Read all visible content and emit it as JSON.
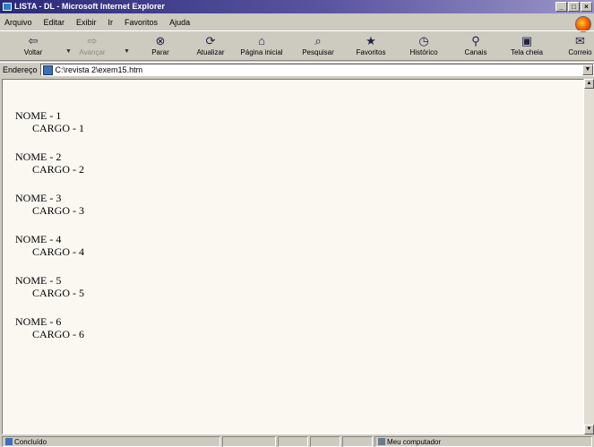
{
  "window": {
    "title": "LISTA - DL - Microsoft Internet Explorer",
    "controls": [
      "_",
      "□",
      "×"
    ]
  },
  "menu": [
    "Arquivo",
    "Editar",
    "Exibir",
    "Ir",
    "Favoritos",
    "Ajuda"
  ],
  "toolbar": [
    {
      "label": "Voltar",
      "icon": "back-arrow-icon",
      "glyph": "⇦",
      "enabled": true
    },
    {
      "label": "Avançar",
      "icon": "forward-arrow-icon",
      "glyph": "⇨",
      "enabled": false
    },
    {
      "label": "Parar",
      "icon": "stop-icon",
      "glyph": "⊗",
      "enabled": true
    },
    {
      "label": "Atualizar",
      "icon": "refresh-icon",
      "glyph": "⟳",
      "enabled": true
    },
    {
      "label": "Página inicial",
      "icon": "home-icon",
      "glyph": "⌂",
      "enabled": true
    },
    {
      "label": "Pesquisar",
      "icon": "search-icon",
      "glyph": "⌕",
      "enabled": true
    },
    {
      "label": "Favoritos",
      "icon": "favorites-icon",
      "glyph": "★",
      "enabled": true
    },
    {
      "label": "Histórico",
      "icon": "history-icon",
      "glyph": "◷",
      "enabled": true
    },
    {
      "label": "Canais",
      "icon": "channels-icon",
      "glyph": "⚲",
      "enabled": true
    },
    {
      "label": "Tela cheia",
      "icon": "fullscreen-icon",
      "glyph": "▣",
      "enabled": true
    },
    {
      "label": "Correio",
      "icon": "mail-icon",
      "glyph": "✉",
      "enabled": true
    }
  ],
  "address": {
    "label": "Endereço",
    "value": "C:\\revista 2\\exem15.htm"
  },
  "entries": [
    {
      "nome": "NOME - 1",
      "cargo": "CARGO - 1"
    },
    {
      "nome": "NOME - 2",
      "cargo": "CARGO - 2"
    },
    {
      "nome": "NOME - 3",
      "cargo": "CARGO - 3"
    },
    {
      "nome": "NOME - 4",
      "cargo": "CARGO - 4"
    },
    {
      "nome": "NOME - 5",
      "cargo": "CARGO - 5"
    },
    {
      "nome": "NOME - 6",
      "cargo": "CARGO - 6"
    }
  ],
  "status": {
    "text": "Concluído",
    "zone": "Meu computador"
  },
  "colors": {
    "titlebar_start": "#2a2a7a",
    "content_bg": "#faf8f1",
    "chrome": "#cdcac0"
  }
}
